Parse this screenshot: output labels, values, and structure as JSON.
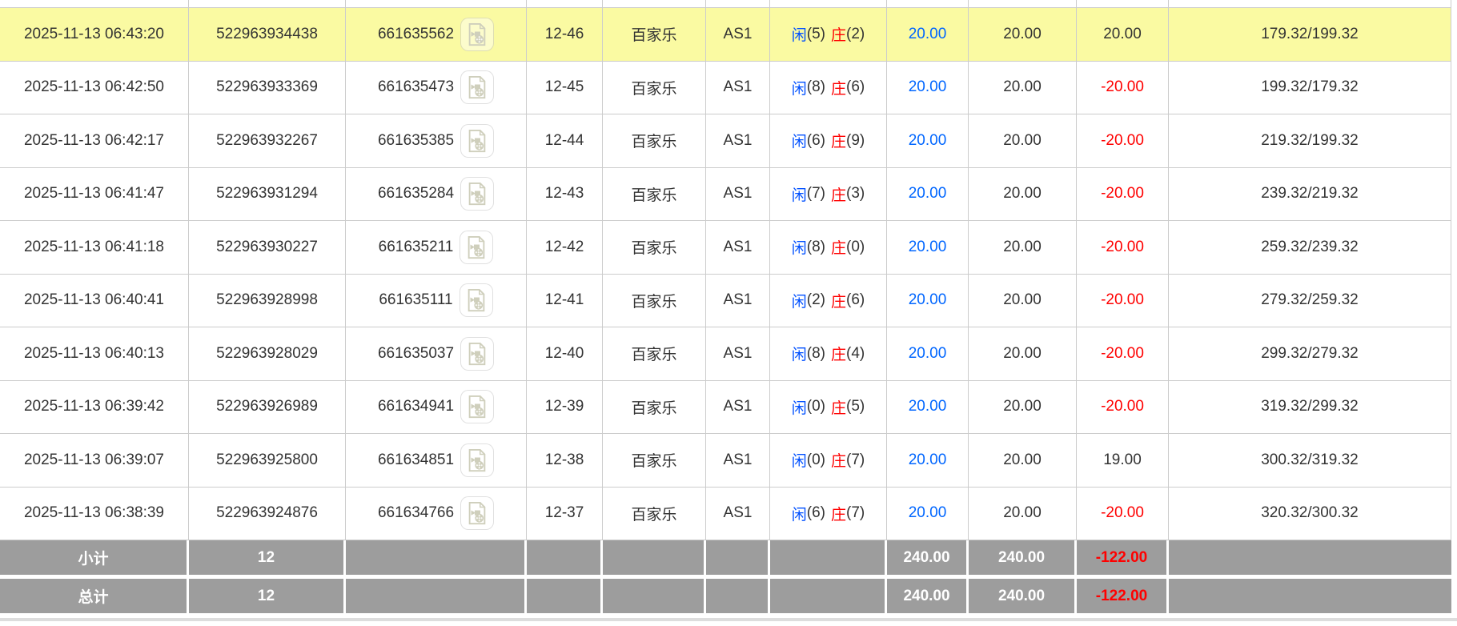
{
  "colors": {
    "highlight-yellow": "#fafaa2",
    "summary-gray": "#9d9d9d",
    "link-blue": "#0066ff",
    "player-blue": "#0050ff",
    "banker-red": "#ff0000",
    "negative-red": "#ff0000",
    "row-border": "#cccccc",
    "text": "#333333"
  },
  "icons": {
    "video-replay-icon": "document page with folded corner containing a video camera and film reel"
  },
  "table": {
    "rows": [
      {
        "time": "2025-11-13 06:43:20",
        "order_no": "522963934438",
        "game_no": "661635562",
        "round": "12-46",
        "game_type": "百家乐",
        "table_name": "AS1",
        "player_label": "闲",
        "player_points": "(5)",
        "banker_label": "庄",
        "banker_points": "(2)",
        "bet": "20.00",
        "valid_bet": "20.00",
        "win_loss": "20.00",
        "balance": "179.32/199.32",
        "highlighted": true
      },
      {
        "time": "2025-11-13 06:42:50",
        "order_no": "522963933369",
        "game_no": "661635473",
        "round": "12-45",
        "game_type": "百家乐",
        "table_name": "AS1",
        "player_label": "闲",
        "player_points": "(8)",
        "banker_label": "庄",
        "banker_points": "(6)",
        "bet": "20.00",
        "valid_bet": "20.00",
        "win_loss": "-20.00",
        "balance": "199.32/179.32",
        "highlighted": false
      },
      {
        "time": "2025-11-13 06:42:17",
        "order_no": "522963932267",
        "game_no": "661635385",
        "round": "12-44",
        "game_type": "百家乐",
        "table_name": "AS1",
        "player_label": "闲",
        "player_points": "(6)",
        "banker_label": "庄",
        "banker_points": "(9)",
        "bet": "20.00",
        "valid_bet": "20.00",
        "win_loss": "-20.00",
        "balance": "219.32/199.32",
        "highlighted": false
      },
      {
        "time": "2025-11-13 06:41:47",
        "order_no": "522963931294",
        "game_no": "661635284",
        "round": "12-43",
        "game_type": "百家乐",
        "table_name": "AS1",
        "player_label": "闲",
        "player_points": "(7)",
        "banker_label": "庄",
        "banker_points": "(3)",
        "bet": "20.00",
        "valid_bet": "20.00",
        "win_loss": "-20.00",
        "balance": "239.32/219.32",
        "highlighted": false
      },
      {
        "time": "2025-11-13 06:41:18",
        "order_no": "522963930227",
        "game_no": "661635211",
        "round": "12-42",
        "game_type": "百家乐",
        "table_name": "AS1",
        "player_label": "闲",
        "player_points": "(8)",
        "banker_label": "庄",
        "banker_points": "(0)",
        "bet": "20.00",
        "valid_bet": "20.00",
        "win_loss": "-20.00",
        "balance": "259.32/239.32",
        "highlighted": false
      },
      {
        "time": "2025-11-13 06:40:41",
        "order_no": "522963928998",
        "game_no": "661635111",
        "round": "12-41",
        "game_type": "百家乐",
        "table_name": "AS1",
        "player_label": "闲",
        "player_points": "(2)",
        "banker_label": "庄",
        "banker_points": "(6)",
        "bet": "20.00",
        "valid_bet": "20.00",
        "win_loss": "-20.00",
        "balance": "279.32/259.32",
        "highlighted": false
      },
      {
        "time": "2025-11-13 06:40:13",
        "order_no": "522963928029",
        "game_no": "661635037",
        "round": "12-40",
        "game_type": "百家乐",
        "table_name": "AS1",
        "player_label": "闲",
        "player_points": "(8)",
        "banker_label": "庄",
        "banker_points": "(4)",
        "bet": "20.00",
        "valid_bet": "20.00",
        "win_loss": "-20.00",
        "balance": "299.32/279.32",
        "highlighted": false
      },
      {
        "time": "2025-11-13 06:39:42",
        "order_no": "522963926989",
        "game_no": "661634941",
        "round": "12-39",
        "game_type": "百家乐",
        "table_name": "AS1",
        "player_label": "闲",
        "player_points": "(0)",
        "banker_label": "庄",
        "banker_points": "(5)",
        "bet": "20.00",
        "valid_bet": "20.00",
        "win_loss": "-20.00",
        "balance": "319.32/299.32",
        "highlighted": false
      },
      {
        "time": "2025-11-13 06:39:07",
        "order_no": "522963925800",
        "game_no": "661634851",
        "round": "12-38",
        "game_type": "百家乐",
        "table_name": "AS1",
        "player_label": "闲",
        "player_points": "(0)",
        "banker_label": "庄",
        "banker_points": "(7)",
        "bet": "20.00",
        "valid_bet": "20.00",
        "win_loss": "19.00",
        "balance": "300.32/319.32",
        "highlighted": false
      },
      {
        "time": "2025-11-13 06:38:39",
        "order_no": "522963924876",
        "game_no": "661634766",
        "round": "12-37",
        "game_type": "百家乐",
        "table_name": "AS1",
        "player_label": "闲",
        "player_points": "(6)",
        "banker_label": "庄",
        "banker_points": "(7)",
        "bet": "20.00",
        "valid_bet": "20.00",
        "win_loss": "-20.00",
        "balance": "320.32/300.32",
        "highlighted": false
      }
    ],
    "subtotal": {
      "label": "小计",
      "count": "12",
      "bet_total": "240.00",
      "valid_total": "240.00",
      "winloss_total": "-122.00"
    },
    "total": {
      "label": "总计",
      "count": "12",
      "bet_total": "240.00",
      "valid_total": "240.00",
      "winloss_total": "-122.00"
    }
  }
}
